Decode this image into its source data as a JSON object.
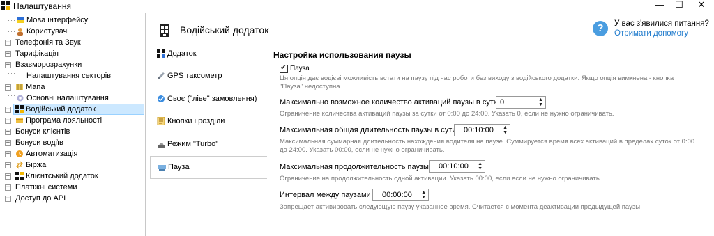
{
  "window": {
    "title": "Налаштування"
  },
  "tree": {
    "items": [
      {
        "label": "Мова інтерфейсу",
        "icon": "flag-icon"
      },
      {
        "label": "Користувачі",
        "icon": "users-icon"
      },
      {
        "label": "Телефонія та Звук",
        "icon": "phone-icon"
      },
      {
        "label": "Тарифікація",
        "icon": "tariff-icon"
      },
      {
        "label": "Взаєморозрахунки",
        "icon": "payments-icon"
      },
      {
        "label": "Налаштування секторів",
        "icon": "sectors-icon"
      },
      {
        "label": "Мапа",
        "icon": "map-icon"
      },
      {
        "label": "Основні налаштування",
        "icon": "gear-icon"
      },
      {
        "label": "Водійський додаток",
        "icon": "driver-app-icon"
      },
      {
        "label": "Програма лояльності",
        "icon": "loyalty-icon"
      },
      {
        "label": "Бонуси клієнтів",
        "icon": "client-bonus-icon"
      },
      {
        "label": "Бонуси водіїв",
        "icon": "driver-bonus-icon"
      },
      {
        "label": "Автоматизація",
        "icon": "automation-icon"
      },
      {
        "label": "Біржа",
        "icon": "exchange-icon"
      },
      {
        "label": "Клієнтський додаток",
        "icon": "client-app-icon"
      },
      {
        "label": "Платіжні системи",
        "icon": "payment-systems-icon"
      },
      {
        "label": "Доступ до API",
        "icon": "api-icon"
      }
    ]
  },
  "header": {
    "title": "Водійський додаток"
  },
  "help": {
    "question": "У вас з'явилися питання?",
    "link": "Отримати допомогу"
  },
  "nav": {
    "items": [
      {
        "label": "Додаток",
        "icon": "app-icon"
      },
      {
        "label": "GPS таксометр",
        "icon": "gps-icon"
      },
      {
        "label": "Своє (\"ліве\" замовлення)",
        "icon": "own-order-icon"
      },
      {
        "label": "Кнопки і розділи",
        "icon": "buttons-icon"
      },
      {
        "label": "Режим \"Turbo\"",
        "icon": "turbo-icon"
      },
      {
        "label": "Пауза",
        "icon": "pause-icon"
      }
    ]
  },
  "pause": {
    "section_title": "Настройка использования паузы",
    "checkbox_label": "Пауза",
    "checkbox_hint_1": "Ця опція дає водієві можливість встати на паузу під час роботи без виходу з водійського додатки. Якщо опція вимкнена - кнопка",
    "checkbox_hint_2": "\"Пауза\" недоступна.",
    "max_count_label": "Максимально возможное количество активаций паузы в сутки",
    "max_count_value": "0",
    "max_count_hint": "Ограничение количества активаций паузы за сутки от 0:00 до 24:00. Указать 0, если не нужно ограничивать.",
    "max_total_label": "Максимальная общая длительность паузы в сути.",
    "max_total_value": "00:10:00",
    "max_total_hint_1": "Максимальная суммарная длительность нахождения водителя на паузе. Суммируется время всех активаций в пределах суток от 0:00",
    "max_total_hint_2": "до 24:00. Указать 00:00, если не нужно ограничивать.",
    "max_dur_label": "Максимальная продолжительность паузы.",
    "max_dur_value": "00:10:00",
    "max_dur_hint": "Ограничение на продолжительность одной активации. Указать 00:00, если если не нужно ограничивать.",
    "interval_label": "Интервал между паузами",
    "interval_value": "00:00:00",
    "interval_hint": "Запрещает активировать следующую паузу указанное время. Считается с момента деактивации предыдущей паузы"
  }
}
